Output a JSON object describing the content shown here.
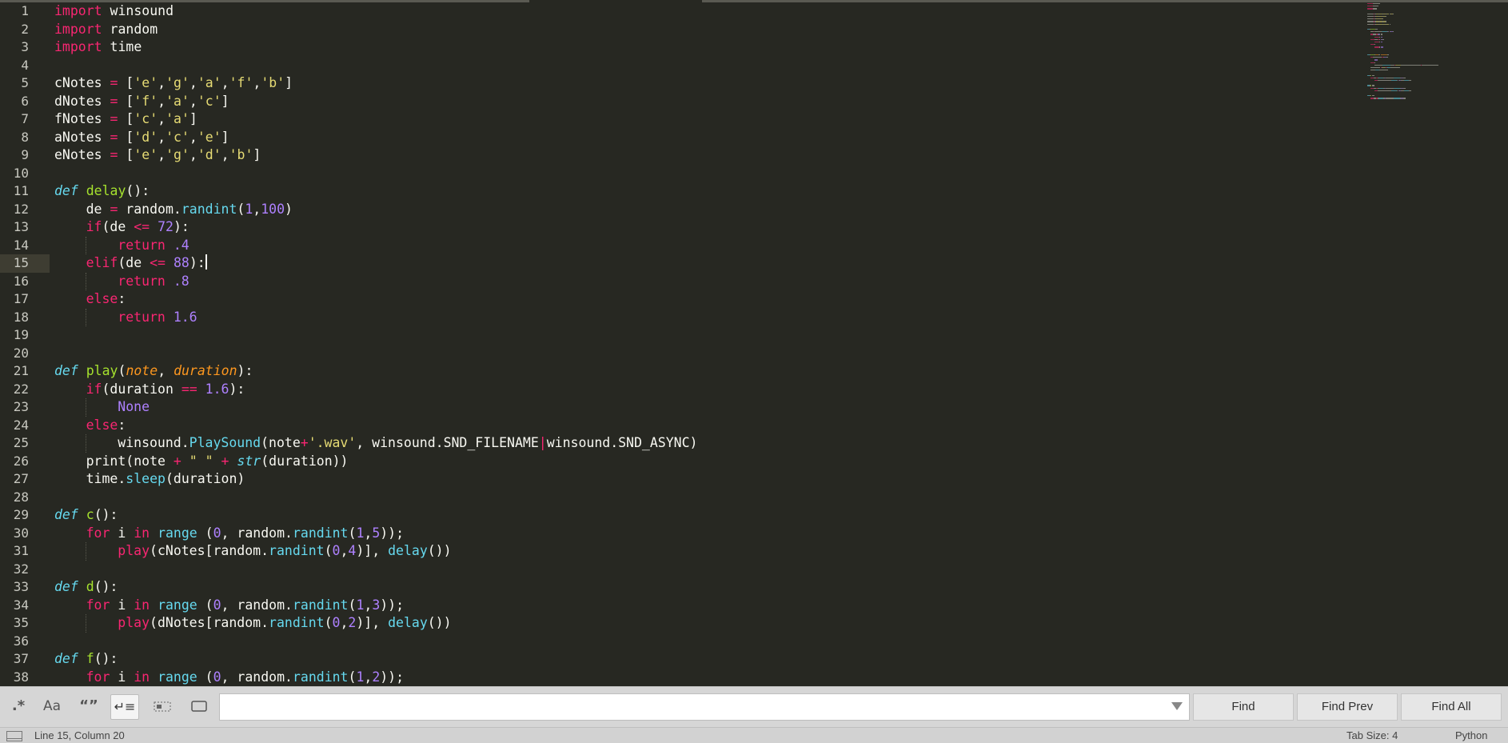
{
  "editor": {
    "current_line": 15,
    "lines": [
      {
        "n": "1",
        "indent": 0,
        "tokens": [
          [
            "kw",
            "import"
          ],
          [
            "pl",
            " winsound"
          ]
        ]
      },
      {
        "n": "2",
        "indent": 0,
        "tokens": [
          [
            "kw",
            "import"
          ],
          [
            "pl",
            " random"
          ]
        ]
      },
      {
        "n": "3",
        "indent": 0,
        "tokens": [
          [
            "kw",
            "import"
          ],
          [
            "pl",
            " time"
          ]
        ]
      },
      {
        "n": "4",
        "indent": 0,
        "tokens": []
      },
      {
        "n": "5",
        "indent": 0,
        "tokens": [
          [
            "pl",
            "cNotes "
          ],
          [
            "op",
            "="
          ],
          [
            "pl",
            " ["
          ],
          [
            "str",
            "'e'"
          ],
          [
            "pl",
            ","
          ],
          [
            "str",
            "'g'"
          ],
          [
            "pl",
            ","
          ],
          [
            "str",
            "'a'"
          ],
          [
            "pl",
            ","
          ],
          [
            "str",
            "'f'"
          ],
          [
            "pl",
            ","
          ],
          [
            "str",
            "'b'"
          ],
          [
            "pl",
            "]"
          ]
        ]
      },
      {
        "n": "6",
        "indent": 0,
        "tokens": [
          [
            "pl",
            "dNotes "
          ],
          [
            "op",
            "="
          ],
          [
            "pl",
            " ["
          ],
          [
            "str",
            "'f'"
          ],
          [
            "pl",
            ","
          ],
          [
            "str",
            "'a'"
          ],
          [
            "pl",
            ","
          ],
          [
            "str",
            "'c'"
          ],
          [
            "pl",
            "]"
          ]
        ]
      },
      {
        "n": "7",
        "indent": 0,
        "tokens": [
          [
            "pl",
            "fNotes "
          ],
          [
            "op",
            "="
          ],
          [
            "pl",
            " ["
          ],
          [
            "str",
            "'c'"
          ],
          [
            "pl",
            ","
          ],
          [
            "str",
            "'a'"
          ],
          [
            "pl",
            "]"
          ]
        ]
      },
      {
        "n": "8",
        "indent": 0,
        "tokens": [
          [
            "pl",
            "aNotes "
          ],
          [
            "op",
            "="
          ],
          [
            "pl",
            " ["
          ],
          [
            "str",
            "'d'"
          ],
          [
            "pl",
            ","
          ],
          [
            "str",
            "'c'"
          ],
          [
            "pl",
            ","
          ],
          [
            "str",
            "'e'"
          ],
          [
            "pl",
            "]"
          ]
        ]
      },
      {
        "n": "9",
        "indent": 0,
        "tokens": [
          [
            "pl",
            "eNotes "
          ],
          [
            "op",
            "="
          ],
          [
            "pl",
            " ["
          ],
          [
            "str",
            "'e'"
          ],
          [
            "pl",
            ","
          ],
          [
            "str",
            "'g'"
          ],
          [
            "pl",
            ","
          ],
          [
            "str",
            "'d'"
          ],
          [
            "pl",
            ","
          ],
          [
            "str",
            "'b'"
          ],
          [
            "pl",
            "]"
          ]
        ]
      },
      {
        "n": "10",
        "indent": 0,
        "tokens": []
      },
      {
        "n": "11",
        "indent": 0,
        "tokens": [
          [
            "def",
            "def"
          ],
          [
            "pl",
            " "
          ],
          [
            "fn",
            "delay"
          ],
          [
            "pl",
            "():"
          ]
        ]
      },
      {
        "n": "12",
        "indent": 1,
        "tokens": [
          [
            "pl",
            "de "
          ],
          [
            "op",
            "="
          ],
          [
            "pl",
            " random."
          ],
          [
            "bi",
            "randint"
          ],
          [
            "pl",
            "("
          ],
          [
            "num",
            "1"
          ],
          [
            "pl",
            ","
          ],
          [
            "num",
            "100"
          ],
          [
            "pl",
            ")"
          ]
        ]
      },
      {
        "n": "13",
        "indent": 1,
        "tokens": [
          [
            "kw",
            "if"
          ],
          [
            "pl",
            "(de "
          ],
          [
            "op",
            "<="
          ],
          [
            "pl",
            " "
          ],
          [
            "num",
            "72"
          ],
          [
            "pl",
            "):"
          ]
        ]
      },
      {
        "n": "14",
        "indent": 2,
        "tokens": [
          [
            "kw",
            "return"
          ],
          [
            "pl",
            " "
          ],
          [
            "num",
            ".4"
          ]
        ]
      },
      {
        "n": "15",
        "indent": 1,
        "tokens": [
          [
            "kw",
            "elif"
          ],
          [
            "pl",
            "(de "
          ],
          [
            "op",
            "<="
          ],
          [
            "pl",
            " "
          ],
          [
            "num",
            "88"
          ],
          [
            "pl",
            "):"
          ],
          [
            "caret",
            ""
          ]
        ]
      },
      {
        "n": "16",
        "indent": 2,
        "tokens": [
          [
            "kw",
            "return"
          ],
          [
            "pl",
            " "
          ],
          [
            "num",
            ".8"
          ]
        ]
      },
      {
        "n": "17",
        "indent": 1,
        "tokens": [
          [
            "kw",
            "else"
          ],
          [
            "pl",
            ":"
          ]
        ]
      },
      {
        "n": "18",
        "indent": 2,
        "tokens": [
          [
            "kw",
            "return"
          ],
          [
            "pl",
            " "
          ],
          [
            "num",
            "1.6"
          ]
        ]
      },
      {
        "n": "19",
        "indent": 0,
        "tokens": []
      },
      {
        "n": "20",
        "indent": 0,
        "tokens": []
      },
      {
        "n": "21",
        "indent": 0,
        "tokens": [
          [
            "def",
            "def"
          ],
          [
            "pl",
            " "
          ],
          [
            "fn",
            "play"
          ],
          [
            "pl",
            "("
          ],
          [
            "par",
            "note"
          ],
          [
            "pl",
            ", "
          ],
          [
            "par",
            "duration"
          ],
          [
            "pl",
            "):"
          ]
        ]
      },
      {
        "n": "22",
        "indent": 1,
        "tokens": [
          [
            "kw",
            "if"
          ],
          [
            "pl",
            "(duration "
          ],
          [
            "op",
            "=="
          ],
          [
            "pl",
            " "
          ],
          [
            "num",
            "1.6"
          ],
          [
            "pl",
            "):"
          ]
        ]
      },
      {
        "n": "23",
        "indent": 2,
        "tokens": [
          [
            "con",
            "None"
          ]
        ]
      },
      {
        "n": "24",
        "indent": 1,
        "tokens": [
          [
            "kw",
            "else"
          ],
          [
            "pl",
            ":"
          ]
        ]
      },
      {
        "n": "25",
        "indent": 2,
        "tokens": [
          [
            "pl",
            "winsound."
          ],
          [
            "bi",
            "PlaySound"
          ],
          [
            "pl",
            "(note"
          ],
          [
            "op",
            "+"
          ],
          [
            "str",
            "'.wav'"
          ],
          [
            "pl",
            ", winsound.SND_FILENAME"
          ],
          [
            "op",
            "|"
          ],
          [
            "pl",
            "winsound.SND_ASYNC)"
          ]
        ]
      },
      {
        "n": "26",
        "indent": 1,
        "tokens": [
          [
            "pl",
            "print(note "
          ],
          [
            "op",
            "+"
          ],
          [
            "pl",
            " "
          ],
          [
            "str",
            "\" \""
          ],
          [
            "pl",
            " "
          ],
          [
            "op",
            "+"
          ],
          [
            "pl",
            " "
          ],
          [
            "bii",
            "str"
          ],
          [
            "pl",
            "(duration))"
          ]
        ]
      },
      {
        "n": "27",
        "indent": 1,
        "tokens": [
          [
            "pl",
            "time."
          ],
          [
            "bi",
            "sleep"
          ],
          [
            "pl",
            "(duration)"
          ]
        ]
      },
      {
        "n": "28",
        "indent": 0,
        "tokens": []
      },
      {
        "n": "29",
        "indent": 0,
        "tokens": [
          [
            "def",
            "def"
          ],
          [
            "pl",
            " "
          ],
          [
            "fn",
            "c"
          ],
          [
            "pl",
            "():"
          ]
        ]
      },
      {
        "n": "30",
        "indent": 1,
        "tokens": [
          [
            "kw",
            "for"
          ],
          [
            "pl",
            " i "
          ],
          [
            "kw",
            "in"
          ],
          [
            "pl",
            " "
          ],
          [
            "bi",
            "range"
          ],
          [
            "pl",
            " ("
          ],
          [
            "num",
            "0"
          ],
          [
            "pl",
            ", random."
          ],
          [
            "bi",
            "randint"
          ],
          [
            "pl",
            "("
          ],
          [
            "num",
            "1"
          ],
          [
            "pl",
            ","
          ],
          [
            "num",
            "5"
          ],
          [
            "pl",
            "));"
          ]
        ]
      },
      {
        "n": "31",
        "indent": 2,
        "tokens": [
          [
            "kw",
            "play"
          ],
          [
            "pl",
            "(cNotes[random."
          ],
          [
            "bi",
            "randint"
          ],
          [
            "pl",
            "("
          ],
          [
            "num",
            "0"
          ],
          [
            "pl",
            ","
          ],
          [
            "num",
            "4"
          ],
          [
            "pl",
            ")], "
          ],
          [
            "bi",
            "delay"
          ],
          [
            "pl",
            "())"
          ]
        ]
      },
      {
        "n": "32",
        "indent": 0,
        "tokens": []
      },
      {
        "n": "33",
        "indent": 0,
        "tokens": [
          [
            "def",
            "def"
          ],
          [
            "pl",
            " "
          ],
          [
            "fn",
            "d"
          ],
          [
            "pl",
            "():"
          ]
        ]
      },
      {
        "n": "34",
        "indent": 1,
        "tokens": [
          [
            "kw",
            "for"
          ],
          [
            "pl",
            " i "
          ],
          [
            "kw",
            "in"
          ],
          [
            "pl",
            " "
          ],
          [
            "bi",
            "range"
          ],
          [
            "pl",
            " ("
          ],
          [
            "num",
            "0"
          ],
          [
            "pl",
            ", random."
          ],
          [
            "bi",
            "randint"
          ],
          [
            "pl",
            "("
          ],
          [
            "num",
            "1"
          ],
          [
            "pl",
            ","
          ],
          [
            "num",
            "3"
          ],
          [
            "pl",
            "));"
          ]
        ]
      },
      {
        "n": "35",
        "indent": 2,
        "tokens": [
          [
            "kw",
            "play"
          ],
          [
            "pl",
            "(dNotes[random."
          ],
          [
            "bi",
            "randint"
          ],
          [
            "pl",
            "("
          ],
          [
            "num",
            "0"
          ],
          [
            "pl",
            ","
          ],
          [
            "num",
            "2"
          ],
          [
            "pl",
            ")], "
          ],
          [
            "bi",
            "delay"
          ],
          [
            "pl",
            "())"
          ]
        ]
      },
      {
        "n": "36",
        "indent": 0,
        "tokens": []
      },
      {
        "n": "37",
        "indent": 0,
        "tokens": [
          [
            "def",
            "def"
          ],
          [
            "pl",
            " "
          ],
          [
            "fn",
            "f"
          ],
          [
            "pl",
            "():"
          ]
        ]
      },
      {
        "n": "38",
        "indent": 1,
        "tokens": [
          [
            "kw",
            "for"
          ],
          [
            "pl",
            " i "
          ],
          [
            "kw",
            "in"
          ],
          [
            "pl",
            " "
          ],
          [
            "bi",
            "range"
          ],
          [
            "pl",
            " ("
          ],
          [
            "num",
            "0"
          ],
          [
            "pl",
            ", random."
          ],
          [
            "bi",
            "randint"
          ],
          [
            "pl",
            "("
          ],
          [
            "num",
            "1"
          ],
          [
            "pl",
            ","
          ],
          [
            "num",
            "2"
          ],
          [
            "pl",
            "));"
          ]
        ]
      }
    ]
  },
  "colors": {
    "background": "#272822",
    "current_line_gutter": "#3e3d32",
    "keyword": "#f92672",
    "function": "#a6e22e",
    "string": "#e6db74",
    "number": "#ae81ff",
    "builtin": "#66d9ef",
    "parameter": "#fd971f"
  },
  "find_panel": {
    "toggles": [
      {
        "name": "regex-toggle",
        "icon": "regex-icon",
        "label": ".*"
      },
      {
        "name": "case-sensitive-toggle",
        "icon": "case-icon",
        "label": "Aa"
      },
      {
        "name": "whole-word-toggle",
        "icon": "quotes-icon",
        "label": "“”"
      },
      {
        "name": "wrap-toggle",
        "icon": "wrap-icon",
        "label": "↵≡"
      },
      {
        "name": "in-selection-toggle",
        "icon": "selection-icon",
        "label": ""
      },
      {
        "name": "highlight-matches-toggle",
        "icon": "highlight-icon",
        "label": ""
      }
    ],
    "search_value": "",
    "find_label": "Find",
    "find_prev_label": "Find Prev",
    "find_all_label": "Find All"
  },
  "status_bar": {
    "position": "Line 15, Column 20",
    "tab_size": "Tab Size: 4",
    "syntax": "Python"
  }
}
